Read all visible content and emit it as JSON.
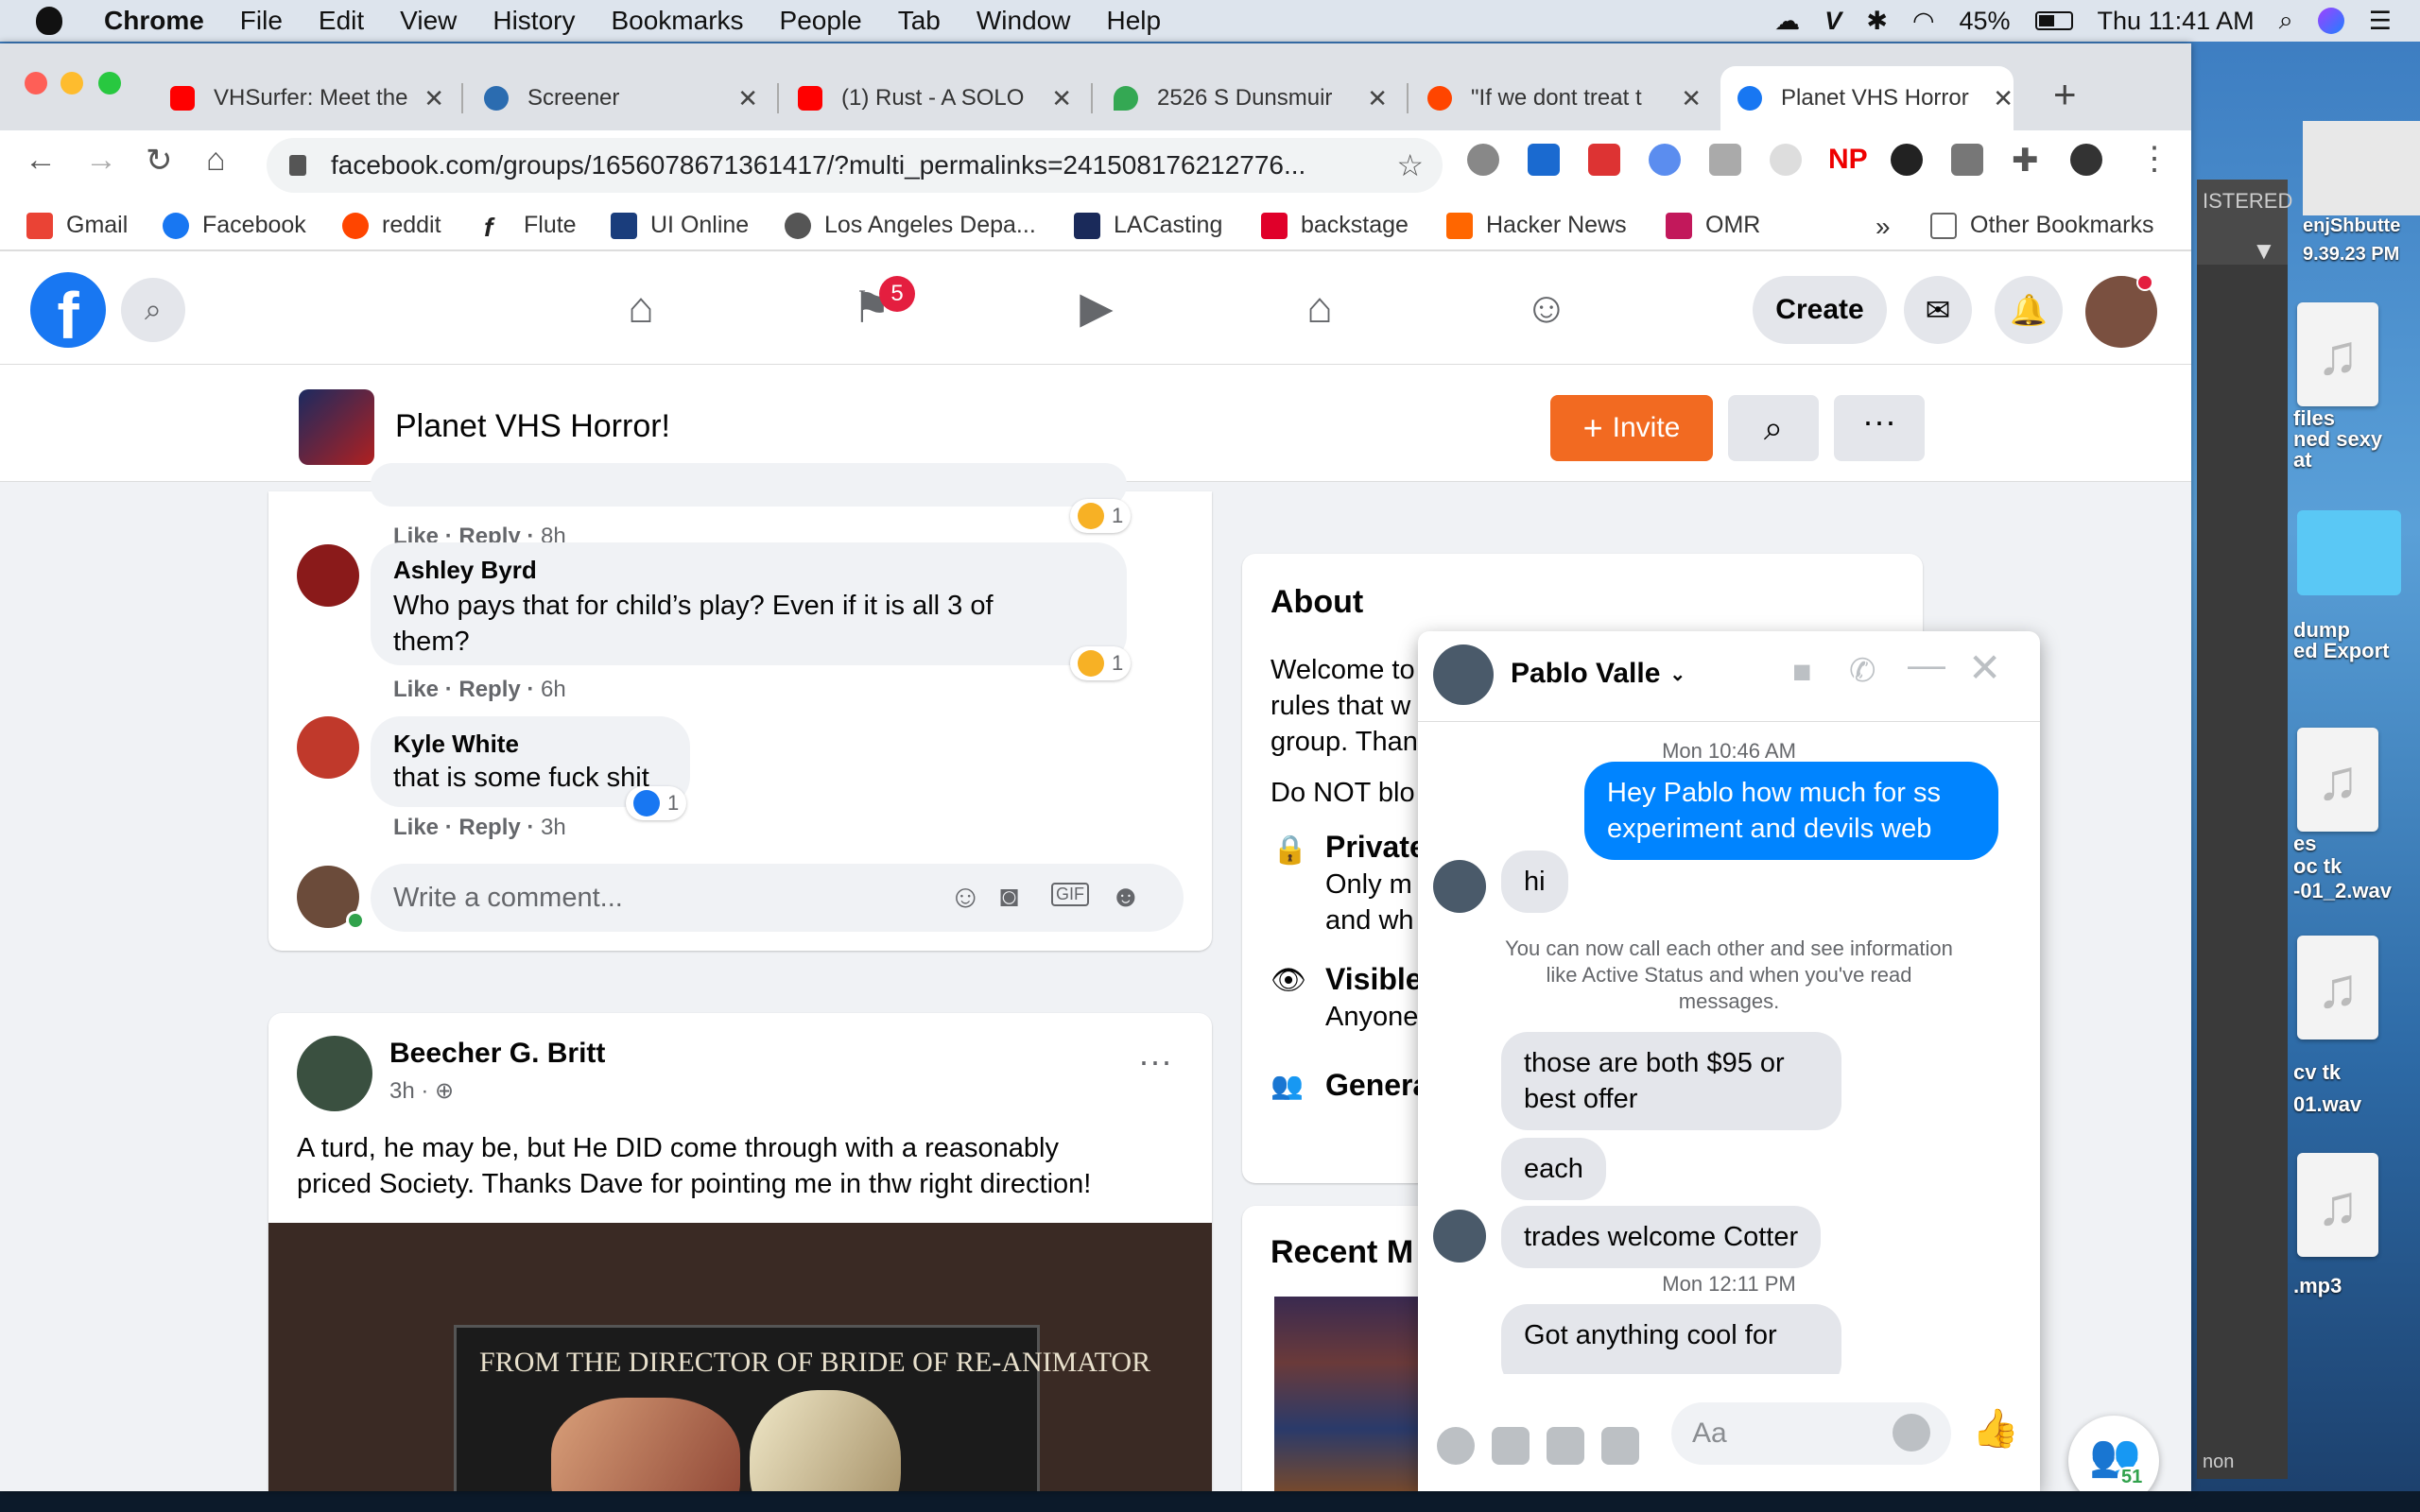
{
  "menubar": {
    "app": "Chrome",
    "items": [
      "File",
      "Edit",
      "View",
      "History",
      "Bookmarks",
      "People",
      "Tab",
      "Window",
      "Help"
    ],
    "battery": "45%",
    "clock": "Thu 11:41 AM"
  },
  "tabs": [
    {
      "title": "VHSurfer: Meet the",
      "color": "#ff0000"
    },
    {
      "title": "Screener",
      "color": "#2b6cb0"
    },
    {
      "title": "(1) Rust - A SOLO",
      "color": "#ff0000"
    },
    {
      "title": "2526 S Dunsmuir",
      "color": "#34a853"
    },
    {
      "title": "\"If we dont treat t",
      "color": "#ff4500"
    },
    {
      "title": "Planet VHS Horror",
      "color": "#1877f2"
    }
  ],
  "address": {
    "url": "facebook.com/groups/1656078671361417/?multi_permalinks=241508176212776..."
  },
  "bookmarks": [
    {
      "label": "Gmail",
      "color": "#ea4335"
    },
    {
      "label": "Facebook",
      "color": "#1877f2"
    },
    {
      "label": "reddit",
      "color": "#ff4500"
    },
    {
      "label": "Flute",
      "color": "#222222"
    },
    {
      "label": "UI Online",
      "color": "#1a3d7c"
    },
    {
      "label": "Los Angeles Depa...",
      "color": "#555555"
    },
    {
      "label": "LACasting",
      "color": "#1a2a5a"
    },
    {
      "label": "backstage",
      "color": "#e0002a"
    },
    {
      "label": "Hacker News",
      "color": "#ff6600"
    },
    {
      "label": "OMR",
      "color": "#c2185b"
    }
  ],
  "bookmarks_more": "»",
  "other_bookmarks": "Other Bookmarks",
  "fbnav": {
    "watch_badge": "5",
    "create": "Create"
  },
  "group": {
    "name": "Planet VHS Horror!",
    "invite": "Invite"
  },
  "comments": [
    {
      "actions": {
        "like": "Like",
        "reply": "Reply",
        "time": "8h"
      },
      "reaction_count": "1"
    },
    {
      "name": "Ashley Byrd",
      "text_line1": "Who pays that for child’s play? Even if it is all 3 of",
      "text_line2": "them?",
      "actions": {
        "like": "Like",
        "reply": "Reply",
        "time": "6h"
      },
      "reaction_count": "1"
    },
    {
      "name": "Kyle White",
      "text": "that is some fuck shit",
      "actions": {
        "like": "Like",
        "reply": "Reply",
        "time": "3h"
      },
      "reaction_count": "1"
    }
  ],
  "comment_box": {
    "placeholder": "Write a comment..."
  },
  "post": {
    "author": "Beecher G. Britt",
    "time": "3h ·",
    "text_line1": "A turd, he may be, but He DID come through with a reasonably",
    "text_line2": "priced Society. Thanks Dave for pointing me in thw right direction!",
    "image_caption": "FROM THE DIRECTOR OF BRIDE OF RE-ANIMATOR"
  },
  "about": {
    "title": "About",
    "line1": "Welcome to the planet! Here are a few simple",
    "line2": "rules that w",
    "line3": "group. Than",
    "line4": "Do NOT blo",
    "private_title": "Private",
    "private_line1": "Only m",
    "private_line2": "and wh",
    "visible_title": "Visible",
    "visible_line": "Anyone",
    "general_title": "Genera"
  },
  "recent_media": {
    "title": "Recent M"
  },
  "chat": {
    "name": "Pablo Valle",
    "stamp1": "Mon 10:46 AM",
    "out1_line1": "Hey Pablo how much for ss",
    "out1_line2": "experiment and devils web",
    "in1": "hi",
    "notice_line1": "You can now call each other and see information",
    "notice_line2": "like Active Status and when you've read",
    "notice_line3": "messages.",
    "in2_line1": "those are both $95 or",
    "in2_line2": "best offer",
    "in3": "each",
    "in4": "trades welcome Cotter",
    "stamp2": "Mon 12:11 PM",
    "in5": "Got anything cool for",
    "input_placeholder": "Aa"
  },
  "contacts_badge": "51",
  "desktop": {
    "labels": [
      "enjShbutte",
      "9.39.23 PM",
      "ISTERED",
      "files",
      "ned sexy",
      "at",
      "dump",
      "ed Export",
      "es",
      "oc tk",
      "-01_2.wav",
      "cv tk",
      "01.wav",
      ".mp3",
      "non"
    ]
  }
}
